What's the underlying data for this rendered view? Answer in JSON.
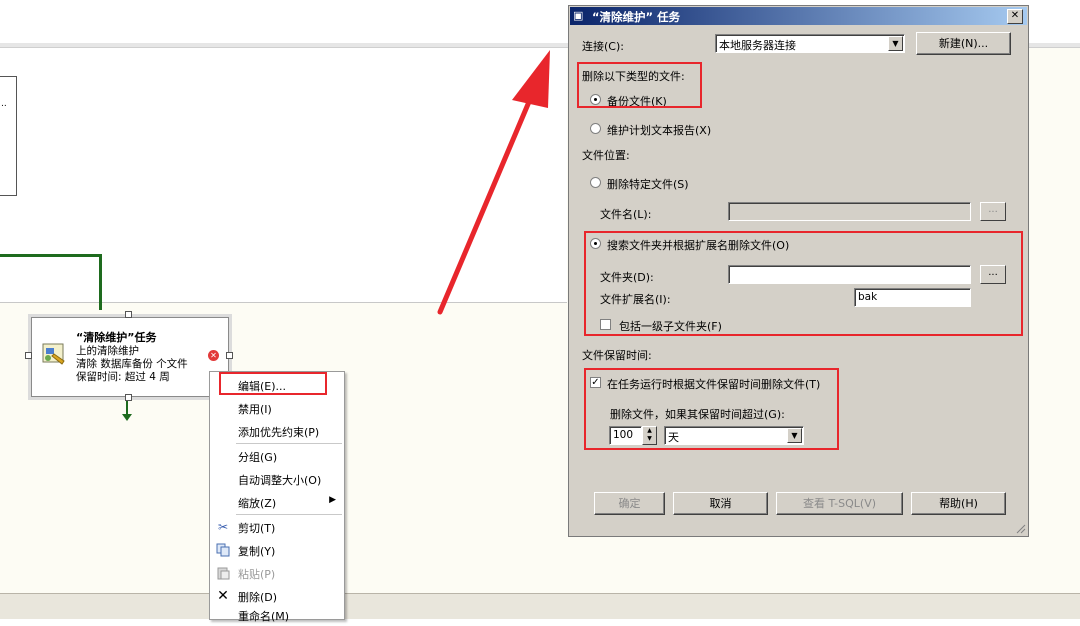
{
  "designer": {
    "prev_task_text": "..",
    "task": {
      "title": "“清除维护”任务",
      "line1": "上的清除维护",
      "line2": "清除 数据库备份 个文件",
      "line3": "保留时间: 超过 4 周"
    }
  },
  "context_menu": {
    "items": [
      {
        "label": "编辑(E)...",
        "icon": "",
        "disabled": false
      },
      {
        "label": "禁用(I)",
        "icon": "",
        "disabled": false
      },
      {
        "label": "添加优先约束(P)",
        "icon": "",
        "disabled": false
      },
      {
        "label": "分组(G)",
        "icon": "",
        "disabled": false
      },
      {
        "label": "自动调整大小(O)",
        "icon": "",
        "disabled": false
      },
      {
        "label": "缩放(Z)",
        "icon": "",
        "disabled": false
      },
      {
        "label": "剪切(T)",
        "icon": "scissors-icon",
        "disabled": false
      },
      {
        "label": "复制(Y)",
        "icon": "copy-icon",
        "disabled": false
      },
      {
        "label": "粘贴(P)",
        "icon": "paste-icon",
        "disabled": true
      },
      {
        "label": "删除(D)",
        "icon": "delete-icon",
        "disabled": false
      },
      {
        "label": "重命名(M)",
        "icon": "",
        "disabled": false
      }
    ]
  },
  "dialog": {
    "title": "“清除维护” 任务",
    "close_glyph": "✕",
    "connection_label": "连接(C):",
    "connection_value": "本地服务器连接",
    "new_button": "新建(N)...",
    "delete_type_label": "删除以下类型的文件:",
    "backup_files": "备份文件(K)",
    "report_files": "维护计划文本报告(X)",
    "file_location_label": "文件位置:",
    "delete_specific": "删除特定文件(S)",
    "filename_label": "文件名(L):",
    "filename_value": "",
    "search_folder": "搜索文件夹并根据扩展名删除文件(O)",
    "folder_label": "文件夹(D):",
    "folder_value": "",
    "ext_label": "文件扩展名(I):",
    "ext_value": "bak",
    "include_subfolders": "包括一级子文件夹(F)",
    "browse": "...",
    "retention_label": "文件保留时间:",
    "retention_check": "在任务运行时根据文件保留时间删除文件(T)",
    "retention_prompt": "删除文件，如果其保留时间超过(G):",
    "retention_value": "100",
    "retention_unit": "天",
    "ok": "确定",
    "cancel": "取消",
    "view_tsql": "查看 T-SQL(V)",
    "help": "帮助(H)"
  },
  "colors": {
    "annotation_red": "#e8262c",
    "titlebar_start": "#0a246a",
    "titlebar_end": "#a6caf0",
    "dialog_bg": "#d4d0c8",
    "connector_green": "#1e6b1e"
  }
}
